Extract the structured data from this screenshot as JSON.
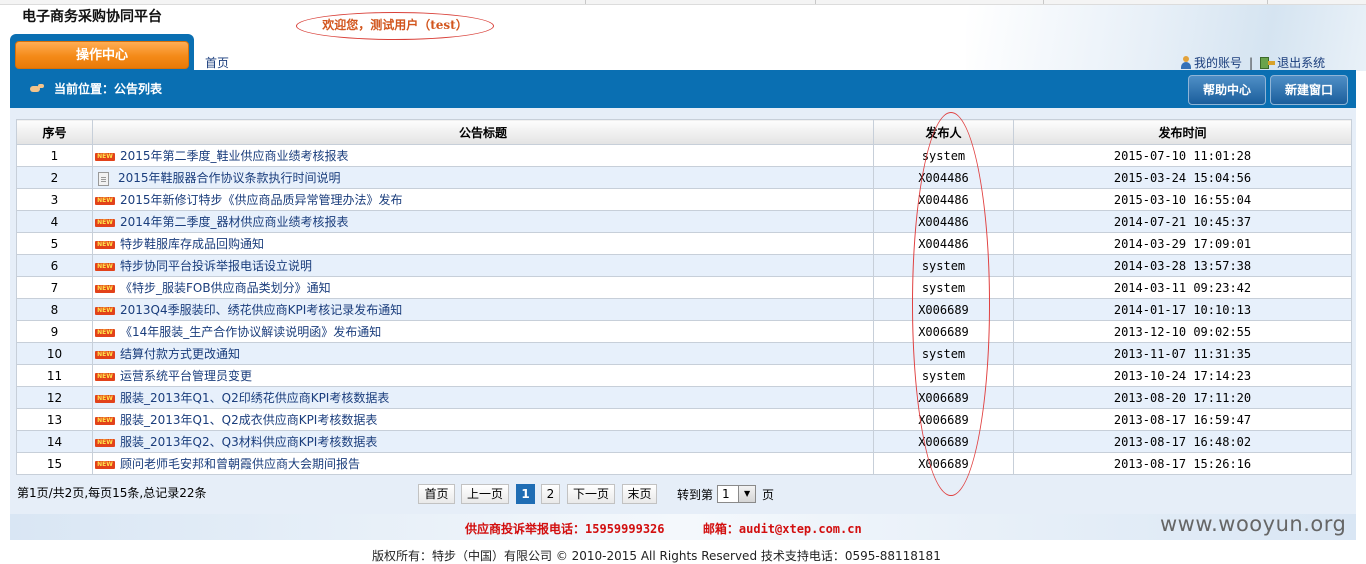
{
  "header": {
    "app_title": "电子商务采购协同平台",
    "welcome": "欢迎您，测试用户（test）",
    "tab_label": "操作中心",
    "home_link": "首页",
    "my_account": "我的账号",
    "separator": "|",
    "logout": "退出系统"
  },
  "bar": {
    "location": "当前位置：公告列表",
    "help_button": "帮助中心",
    "new_window_button": "新建窗口"
  },
  "table": {
    "columns": [
      "序号",
      "公告标题",
      "发布人",
      "发布时间"
    ],
    "rows": [
      {
        "no": "1",
        "icon": "new-icon",
        "title": "2015年第二季度_鞋业供应商业绩考核报表",
        "publisher": "system",
        "time": "2015-07-10 11:01:28"
      },
      {
        "no": "2",
        "icon": "document-icon",
        "title": "2015年鞋服器合作协议条款执行时间说明",
        "publisher": "X004486",
        "time": "2015-03-24 15:04:56"
      },
      {
        "no": "3",
        "icon": "new-icon",
        "title": "2015年新修订特步《供应商品质异常管理办法》发布",
        "publisher": "X004486",
        "time": "2015-03-10 16:55:04"
      },
      {
        "no": "4",
        "icon": "new-icon",
        "title": "2014年第二季度_器材供应商业绩考核报表",
        "publisher": "X004486",
        "time": "2014-07-21 10:45:37"
      },
      {
        "no": "5",
        "icon": "new-icon",
        "title": "特步鞋服库存成品回购通知",
        "publisher": "X004486",
        "time": "2014-03-29 17:09:01"
      },
      {
        "no": "6",
        "icon": "new-icon",
        "title": "特步协同平台投诉举报电话设立说明",
        "publisher": "system",
        "time": "2014-03-28 13:57:38"
      },
      {
        "no": "7",
        "icon": "new-icon",
        "title": "《特步_服装FOB供应商品类划分》通知",
        "publisher": "system",
        "time": "2014-03-11 09:23:42"
      },
      {
        "no": "8",
        "icon": "new-icon",
        "title": "2013Q4季服装印、绣花供应商KPI考核记录发布通知",
        "publisher": "X006689",
        "time": "2014-01-17 10:10:13"
      },
      {
        "no": "9",
        "icon": "new-icon",
        "title": "《14年服装_生产合作协议解读说明函》发布通知",
        "publisher": "X006689",
        "time": "2013-12-10 09:02:55"
      },
      {
        "no": "10",
        "icon": "new-icon",
        "title": "结算付款方式更改通知",
        "publisher": "system",
        "time": "2013-11-07 11:31:35"
      },
      {
        "no": "11",
        "icon": "new-icon",
        "title": "运营系统平台管理员变更",
        "publisher": "system",
        "time": "2013-10-24 17:14:23"
      },
      {
        "no": "12",
        "icon": "new-icon",
        "title": "服装_2013年Q1、Q2印绣花供应商KPI考核数据表",
        "publisher": "X006689",
        "time": "2013-08-20 17:11:20"
      },
      {
        "no": "13",
        "icon": "new-icon",
        "title": "服装_2013年Q1、Q2成衣供应商KPI考核数据表",
        "publisher": "X006689",
        "time": "2013-08-17 16:59:47"
      },
      {
        "no": "14",
        "icon": "new-icon",
        "title": "服装_2013年Q2、Q3材料供应商KPI考核数据表",
        "publisher": "X006689",
        "time": "2013-08-17 16:48:02"
      },
      {
        "no": "15",
        "icon": "new-icon",
        "title": "顾问老师毛安邦和曾朝霞供应商大会期间报告",
        "publisher": "X006689",
        "time": "2013-08-17 15:26:16"
      }
    ],
    "new_badge_text": "NEW"
  },
  "pager": {
    "info": "第1页/共2页,每页15条,总记录22条",
    "first": "首页",
    "prev": "上一页",
    "pages": [
      "1",
      "2"
    ],
    "current_page": "1",
    "next": "下一页",
    "last": "末页",
    "jump_prefix": "转到第",
    "jump_value": "1",
    "jump_suffix": "页"
  },
  "footer": {
    "complaint_label": "供应商投诉举报电话：",
    "complaint_phone": "15959999326",
    "mail_label": "邮箱：",
    "mail_value": "audit@xtep.com.cn",
    "copyright": "版权所有：特步（中国）有限公司 © 2010-2015  All Rights Reserved  技术支持电话：0595-88118181",
    "watermark": "www.wooyun.org"
  },
  "colors": {
    "primary_blue": "#0a6fb2",
    "tab_orange": "#f48a18",
    "link": "#1a3d7c",
    "alt_row": "#e7f0fb",
    "footer_red": "#d20f0f",
    "annotation_red": "#e04040"
  }
}
